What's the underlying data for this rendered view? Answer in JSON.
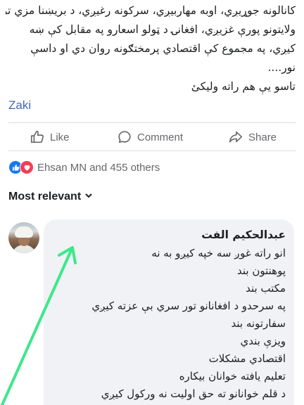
{
  "post": {
    "text_lines": [
      "کانالونه جوړیږي، اوبه مهاربیږي، سرکونه رغیږي، د بریښنا مزي تر",
      "ولایتونو پورې غزیږي، افغانۍ د ټولو اسعارو په مقابل کې ښه",
      "کیږي، په مجموع کې اقتصادي پرمختګونه روان دي او داسې",
      "نور....",
      "تاسو يې هم راته ولیکئ"
    ],
    "author_link": "Zaki"
  },
  "actions": {
    "like": "Like",
    "comment": "Comment",
    "share": "Share",
    "icons": [
      "thumbs-up-icon",
      "speech-bubble-icon",
      "share-arrow-icon"
    ]
  },
  "reactions": {
    "icons": [
      "like-icon",
      "love-icon"
    ],
    "summary": "Ehsan MN and 455 others"
  },
  "sort": {
    "label": "Most relevant",
    "icon": "chevron-down-icon"
  },
  "comment": {
    "author": "عبدالحکیم الفت",
    "lines": [
      "انو راته غوږ سه خپه کیږو به نه",
      "پوهنتون بند",
      "مکتب بند",
      "په سرحدو د افغانانو تور سري بې عزته کیږي",
      "سفارتونه بند",
      "ویزې بندي",
      "اقتصادي مشکلات",
      "تعلیم یافته خوانان بیکاره",
      "د قلم خوانانو ته حق اولیت نه ورکول کیږي"
    ]
  },
  "colors": {
    "text": "#1c1e21",
    "secondary_text": "#65676b",
    "link": "#4267b2",
    "comment_bubble": "#f0f2f5",
    "like_reaction": "#1877f2",
    "love_reaction": "#f33e58",
    "annotation_arrow": "#3de88a"
  }
}
